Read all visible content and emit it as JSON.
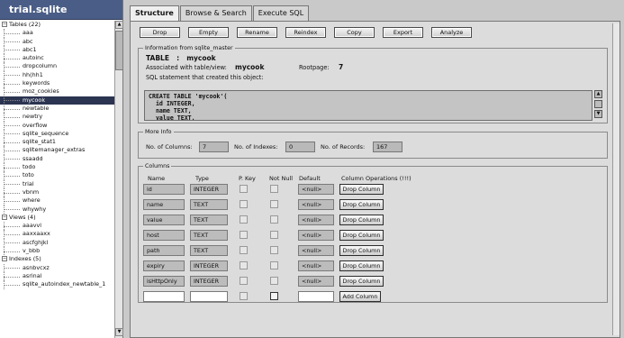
{
  "sidebar": {
    "db_title": "trial.sqlite",
    "tables_group": "Tables (22)",
    "tables": [
      "aaa",
      "abc",
      "abc1",
      "autoinc",
      "dropcolumn",
      "hh(hh1",
      "keywords",
      "moz_cookies",
      "mycook",
      "newtable",
      "newtry",
      "overflow",
      "sqlite_sequence",
      "sqlite_stat1",
      "sqlitemanager_extras",
      "ssaadd",
      "todo",
      "toto",
      "trial",
      "vbnm",
      "where",
      "whywhy"
    ],
    "selected_table": "mycook",
    "views_group": "Views (4)",
    "views": [
      "aaavvl",
      "aaxxaaxx",
      "ascfghjkl",
      "v_bbb"
    ],
    "indexes_group": "Indexes (5)",
    "indexes": [
      "asnbvcxz",
      "asrinal",
      "sqlite_autoindex_newtable_1"
    ]
  },
  "tabs": [
    "Structure",
    "Browse & Search",
    "Execute SQL"
  ],
  "active_tab": "Structure",
  "toolbar": [
    "Drop",
    "Empty",
    "Rename",
    "Reindex",
    "Copy",
    "Export",
    "Analyze"
  ],
  "master": {
    "legend": "Information from sqlite_master",
    "type_label": "TABLE",
    "colon": ":",
    "name": "mycook",
    "assoc_label": "Associated with table/view:",
    "assoc_value": "mycook",
    "rootpage_label": "Rootpage:",
    "rootpage_value": "7",
    "sql_label": "SQL statement that created this object:",
    "sql": "CREATE TABLE 'mycook'(\n  id INTEGER,\n  name TEXT,\n  value TEXT,"
  },
  "more_info": {
    "legend": "More Info",
    "columns_label": "No. of Columns:",
    "columns_value": "7",
    "indexes_label": "No. of Indexes:",
    "indexes_value": "0",
    "records_label": "No. of Records:",
    "records_value": "167"
  },
  "columns_panel": {
    "legend": "Columns",
    "headers": {
      "name": "Name",
      "type": "Type",
      "pkey": "P. Key",
      "notnull": "Not Null",
      "default": "Default",
      "ops": "Column Operations (!!!)"
    },
    "rows": [
      {
        "name": "id",
        "type": "INTEGER",
        "default": "<null>",
        "op": "Drop Column"
      },
      {
        "name": "name",
        "type": "TEXT",
        "default": "<null>",
        "op": "Drop Column"
      },
      {
        "name": "value",
        "type": "TEXT",
        "default": "<null>",
        "op": "Drop Column"
      },
      {
        "name": "host",
        "type": "TEXT",
        "default": "<null>",
        "op": "Drop Column"
      },
      {
        "name": "path",
        "type": "TEXT",
        "default": "<null>",
        "op": "Drop Column"
      },
      {
        "name": "expiry",
        "type": "INTEGER",
        "default": "<null>",
        "op": "Drop Column"
      },
      {
        "name": "isHttpOnly",
        "type": "INTEGER",
        "default": "<null>",
        "op": "Drop Column"
      }
    ],
    "add_label": "Add Column"
  },
  "icons": {
    "expanded": "−",
    "scroll_up": "▲",
    "scroll_down": "▼"
  }
}
